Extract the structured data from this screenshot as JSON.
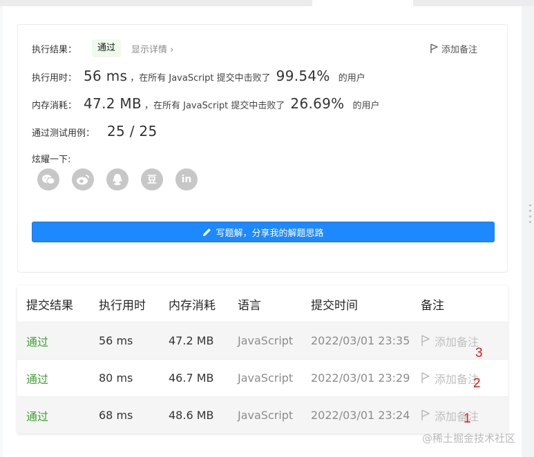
{
  "result": {
    "label": "执行结果：",
    "status": "通过",
    "detail_link": "显示详情 ›",
    "add_note": "添加备注",
    "runtime": {
      "label": "执行用时：",
      "value": "56 ms",
      "text": "，在所有 JavaScript 提交中击败了",
      "percent": "99.54%",
      "suffix": "的用户"
    },
    "memory": {
      "label": "内存消耗：",
      "value": "47.2 MB",
      "text": "，在所有 JavaScript 提交中击败了",
      "percent": "26.69%",
      "suffix": "的用户"
    },
    "tests": {
      "label": "通过测试用例：",
      "value": "25 / 25"
    },
    "share": {
      "label": "炫耀一下:",
      "icons": [
        "wechat-icon",
        "weibo-icon",
        "qq-icon",
        "douban-icon",
        "linkedin-icon"
      ],
      "douban_glyph": "豆",
      "linkedin_glyph": "in"
    },
    "solution_button": "写题解，分享我的解题思路"
  },
  "table": {
    "headers": [
      "提交结果",
      "执行用时",
      "内存消耗",
      "语言",
      "提交时间",
      "备注"
    ],
    "rows": [
      {
        "status": "通过",
        "runtime": "56 ms",
        "memory": "47.2 MB",
        "language": "JavaScript",
        "time": "2022/03/01 23:35",
        "note": "添加备注",
        "annotation": "3"
      },
      {
        "status": "通过",
        "runtime": "80 ms",
        "memory": "46.7 MB",
        "language": "JavaScript",
        "time": "2022/03/01 23:29",
        "note": "添加备注",
        "annotation": "2"
      },
      {
        "status": "通过",
        "runtime": "68 ms",
        "memory": "48.6 MB",
        "language": "JavaScript",
        "time": "2022/03/01 23:24",
        "note": "添加备注",
        "annotation": "1"
      }
    ]
  },
  "watermark": "@稀土掘金技术社区",
  "colors": {
    "pass_green": "#3aa22d",
    "primary_blue": "#1e88ff",
    "annotation_red": "#e01818"
  }
}
